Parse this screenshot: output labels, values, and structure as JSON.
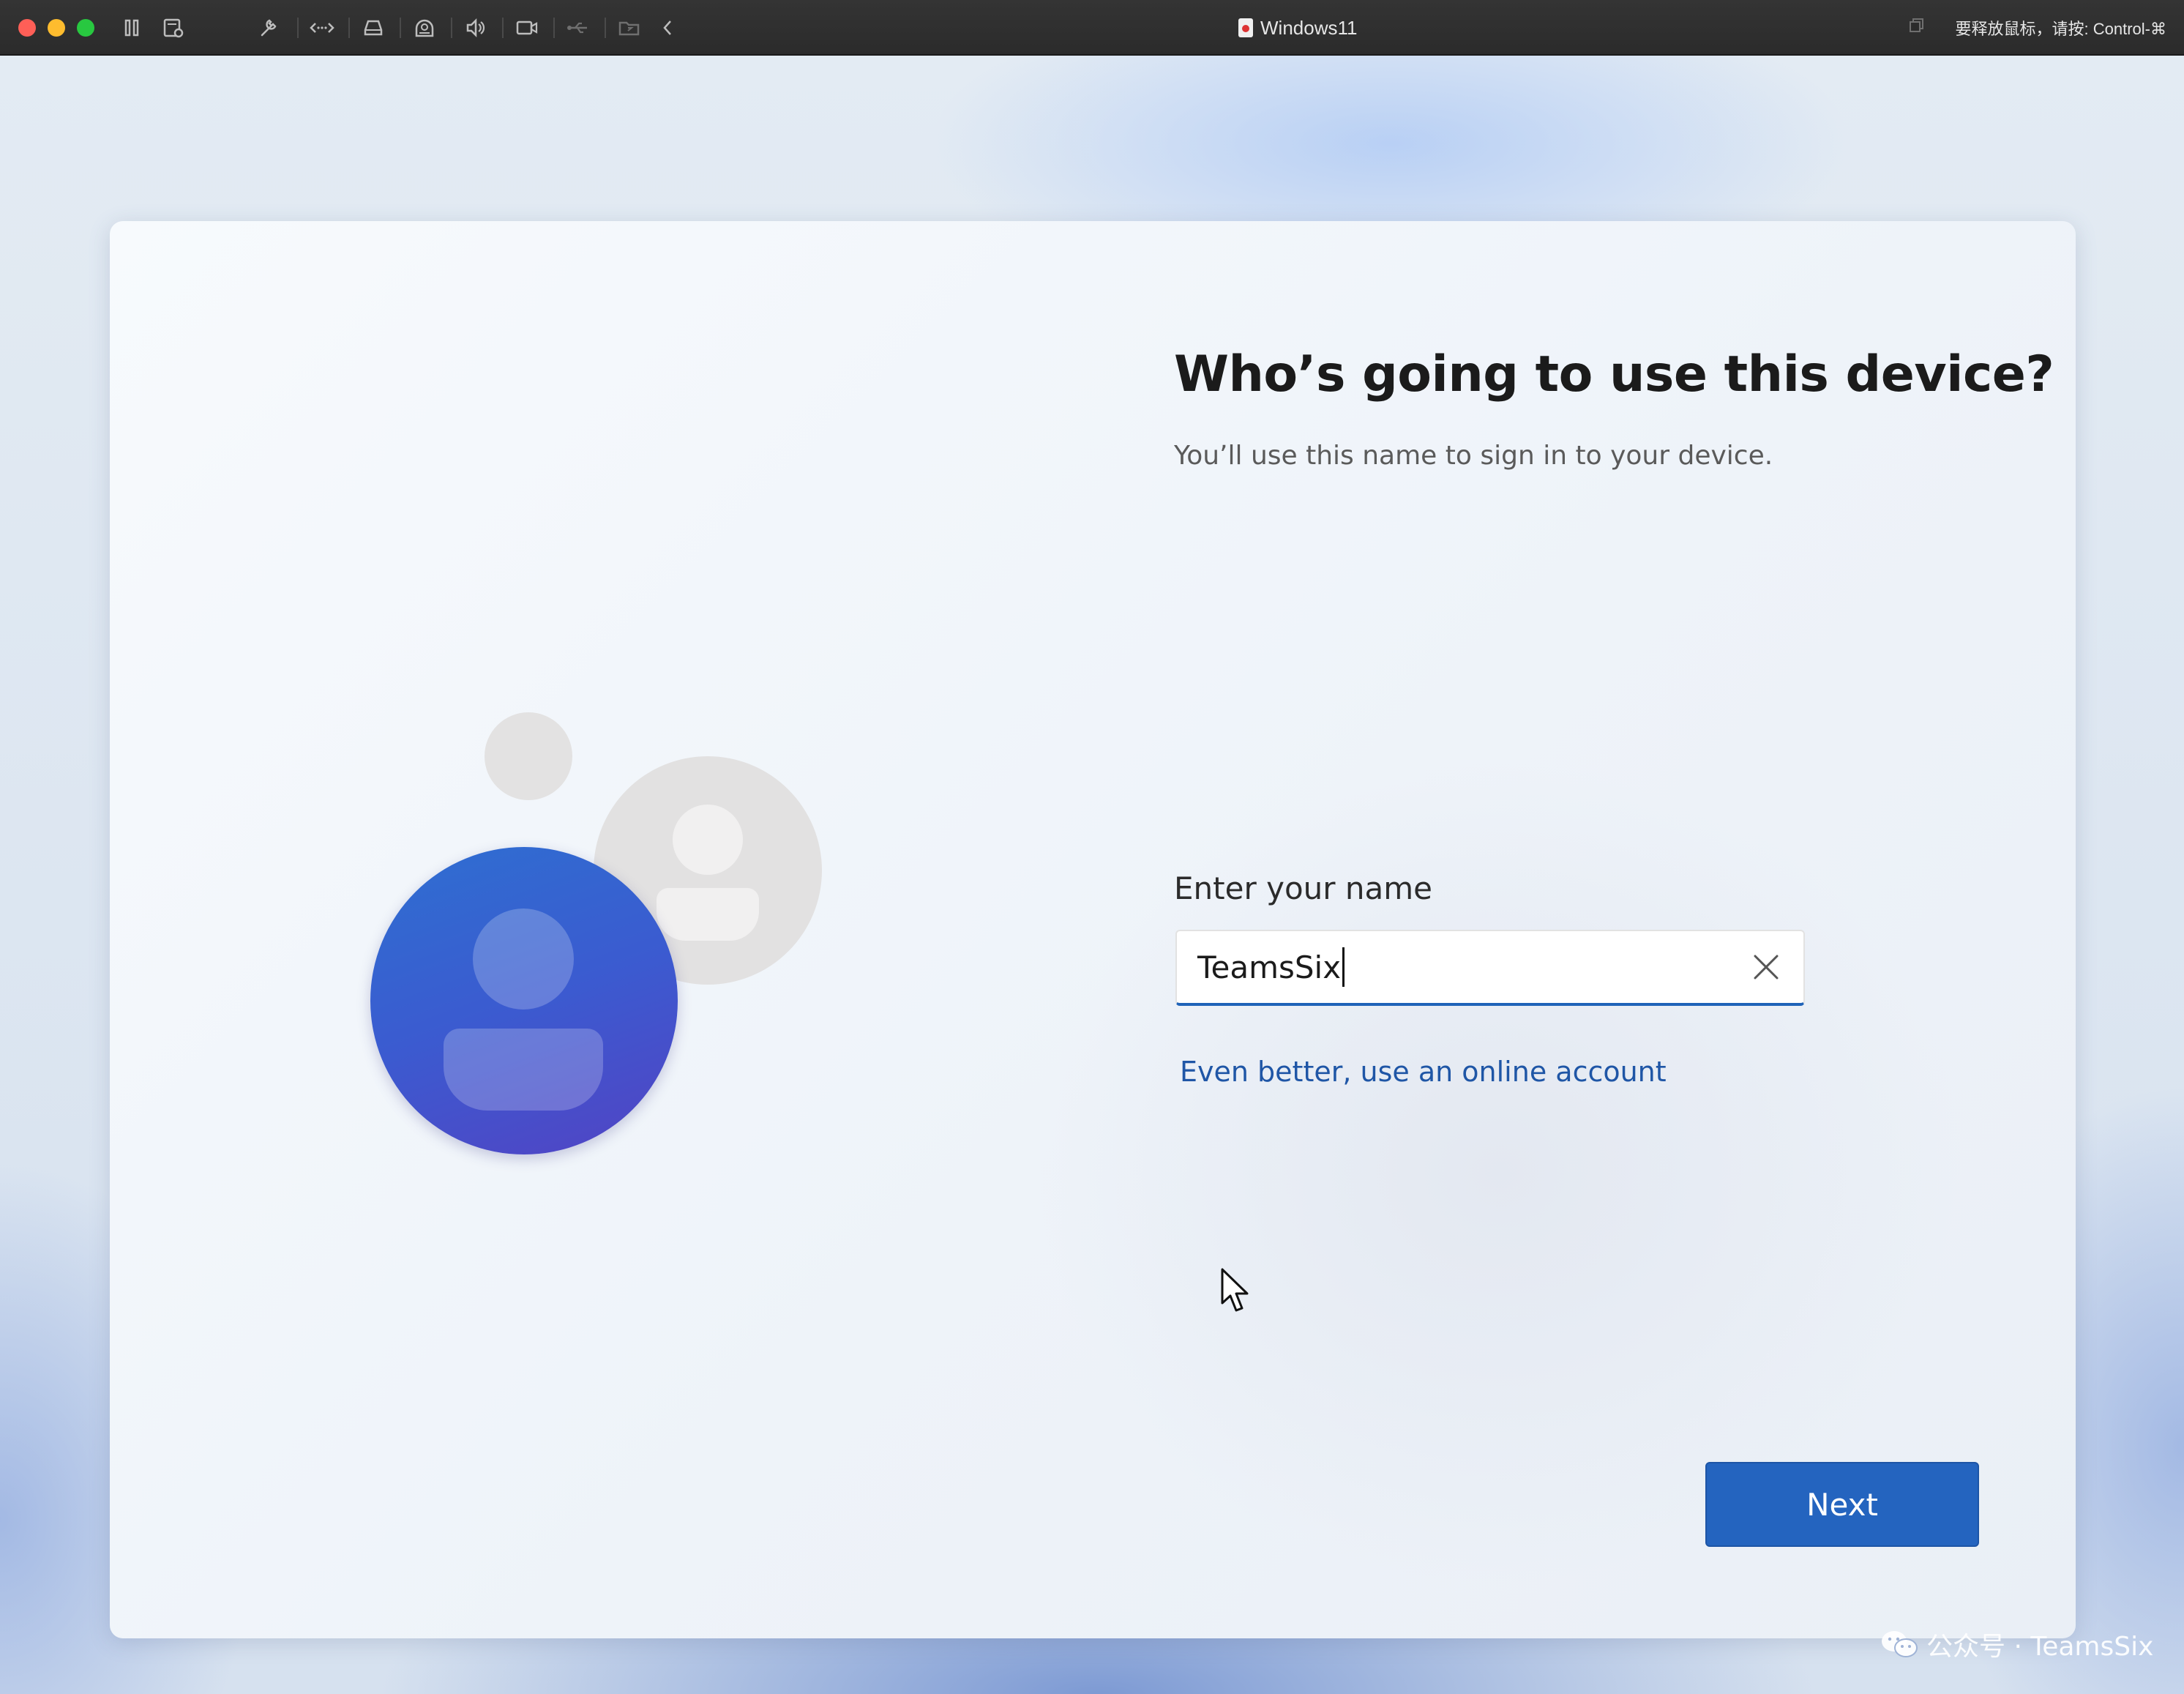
{
  "window": {
    "title": "Windows11",
    "release_hint": "要释放鼠标，请按: Control-⌘"
  },
  "toolbar": {
    "icons": [
      "pause-icon",
      "snapshot-icon",
      "settings-wrench-icon",
      "network-icon",
      "disk-icon",
      "printer-icon",
      "sound-icon",
      "camera-icon",
      "usb-icon",
      "shared-folder-icon",
      "collapse-arrow-icon"
    ]
  },
  "oobe": {
    "heading": "Who’s going to use this device?",
    "subheading": "You’ll use this name to sign in to your device.",
    "name_label": "Enter your name",
    "name_value": "TeamsSix",
    "online_account_link": "Even better, use an online account",
    "next_label": "Next"
  },
  "colors": {
    "accent": "#2464bf",
    "link": "#1f56a6",
    "avatar_gradient_start": "#2e6fd1",
    "avatar_gradient_end": "#5243c4"
  },
  "watermark": {
    "text": "公众号 · TeamsSix"
  }
}
